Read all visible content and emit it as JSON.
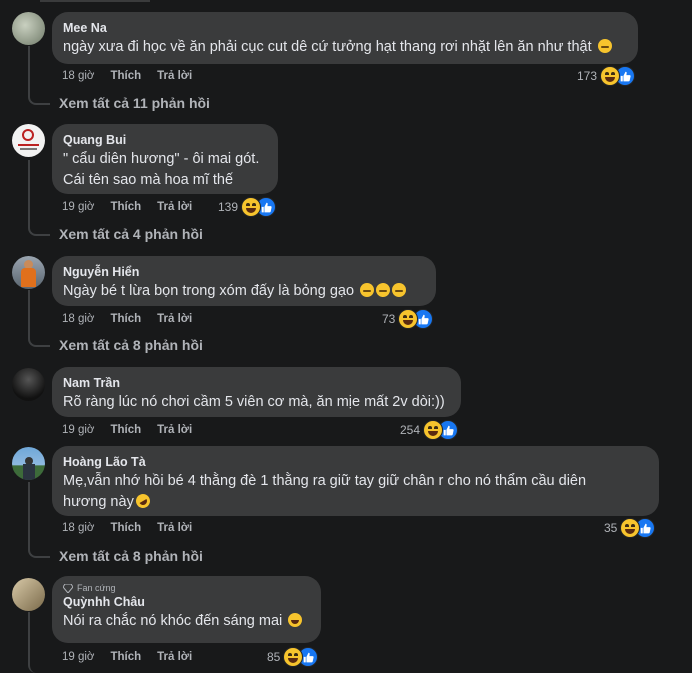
{
  "actions": {
    "like": "Thích",
    "reply": "Trả lời"
  },
  "comments": [
    {
      "name": "Mee Na",
      "text": "ngày xưa đi học về ăn phải cục cut dê cứ tưởng hạt thang rơi nhặt lên ăn như thật",
      "time": "18 giờ",
      "reactions": "173",
      "replies": "Xem tất cả 11 phản hồi"
    },
    {
      "name": "Quang Bui",
      "text_line1": "\" cẩu diên hương\" - ôi mai gót.",
      "text_line2": "Cái tên sao mà hoa mĩ thế",
      "time": "19 giờ",
      "reactions": "139",
      "replies": "Xem tất cả 4 phản hồi"
    },
    {
      "name": "Nguyễn Hiển",
      "text": "Ngày bé t lừa bọn trong xóm đấy là bỏng gạo",
      "time": "18 giờ",
      "reactions": "73",
      "replies": "Xem tất cả 8 phản hồi"
    },
    {
      "name": "Nam Trần",
      "text": "Rõ ràng lúc nó chơi cầm 5 viên cơ mà, ăn mịe mất 2v dòi:))",
      "time": "19 giờ",
      "reactions": "254"
    },
    {
      "name": "Hoàng Lão Tà",
      "text_line1": "Mẹ,vẫn nhớ hồi bé 4 thằng đè 1 thằng ra giữ tay giữ chân r cho nó thẩm cầu diên",
      "text_line2": "hương này",
      "time": "18 giờ",
      "reactions": "35",
      "replies": "Xem tất cả 8 phản hồi"
    },
    {
      "badge": "Fan cứng",
      "name": "Quỳnhh Châu",
      "text": "Nói ra chắc nó khóc đến sáng mai",
      "time": "19 giờ",
      "reactions": "85"
    }
  ],
  "colors": {
    "bubble": "#3a3b3c",
    "like_blue": "#1877f2",
    "haha_yellow": "#f7c42d"
  },
  "icons": [
    "haha-reaction-icon",
    "like-reaction-icon",
    "diamond-badge-icon"
  ]
}
